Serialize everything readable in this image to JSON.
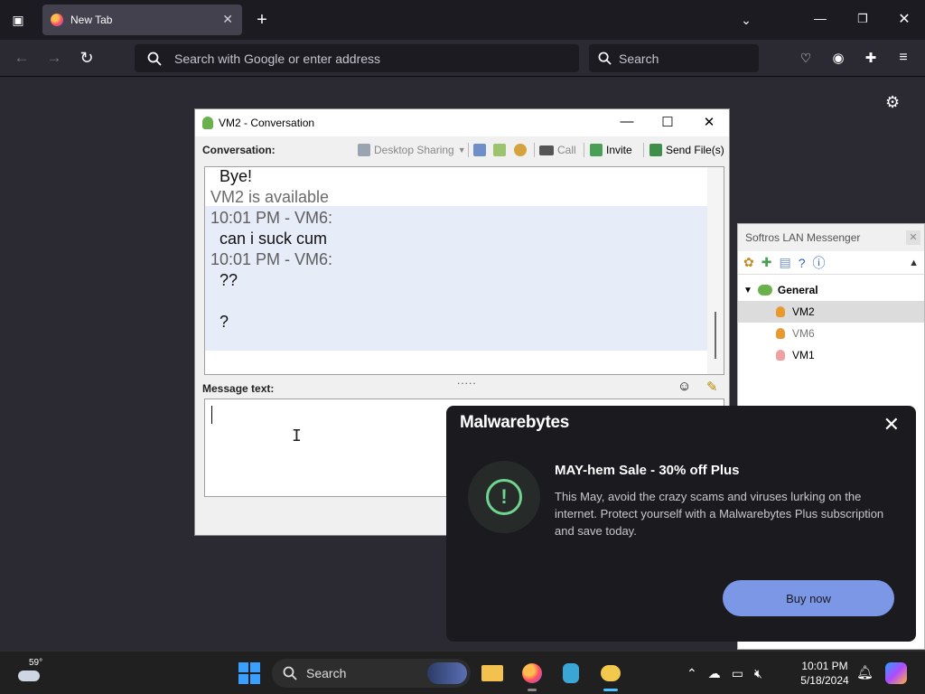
{
  "browser": {
    "tab_title": "New Tab",
    "url_placeholder": "Search with Google or enter address",
    "search_placeholder": "Search"
  },
  "conversation": {
    "title": "VM2 - Conversation",
    "label": "Conversation:",
    "toolbar": {
      "desktop_sharing": "Desktop Sharing",
      "call": "Call",
      "invite": "Invite",
      "send_files": "Send File(s)"
    },
    "messages": [
      {
        "text": "Bye!",
        "kind": "msg"
      },
      {
        "text": "VM2 is available",
        "kind": "sys"
      },
      {
        "text": "10:01 PM - VM6:",
        "kind": "meta"
      },
      {
        "text": "can i suck cum",
        "kind": "msg"
      },
      {
        "text": "10:01 PM - VM6:",
        "kind": "meta"
      },
      {
        "text": "??",
        "kind": "msg"
      },
      {
        "text": "?",
        "kind": "msg"
      }
    ],
    "message_label": "Message text:",
    "split_dots": "....."
  },
  "lan_messenger": {
    "title": "Softros LAN Messenger",
    "group": "General",
    "users": [
      {
        "name": "VM2",
        "color": "#e89a2e",
        "selected": true
      },
      {
        "name": "VM6",
        "color": "#e89a2e",
        "selected": false
      },
      {
        "name": "VM1",
        "color": "#f0a0a0",
        "selected": false
      }
    ]
  },
  "malwarebytes": {
    "logo": "Malwarebytes",
    "heading": "MAY-hem Sale - 30% off Plus",
    "body": "This May, avoid the crazy scams and viruses lurking on the internet. Protect yourself with a Malwarebytes Plus subscription and save today.",
    "button": "Buy now"
  },
  "taskbar": {
    "temperature": "59°",
    "search_label": "Search",
    "time": "10:01 PM",
    "date": "5/18/2024"
  },
  "colors": {
    "accent_blue": "#3aa0ff",
    "malwarebytes_button": "#7b97e6",
    "alert_green": "#6fd392"
  }
}
